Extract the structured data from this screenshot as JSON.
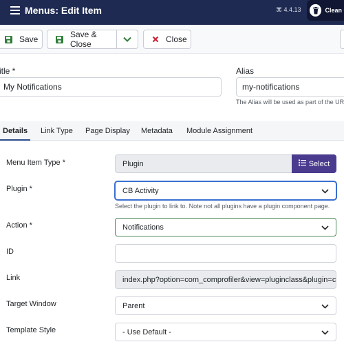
{
  "header": {
    "title": "Menus: Edit Item",
    "version": "⌘ 4.4.13",
    "clean_cache_label": "Clean C"
  },
  "toolbar": {
    "save_label": "Save",
    "save_close_label": "Save & Close",
    "close_label": "Close"
  },
  "details": {
    "title_label": "itle *",
    "title_value": "My Notifications",
    "alias_label": "Alias",
    "alias_value": "my-notifications",
    "alias_hint": "The Alias will be used as part of the UR"
  },
  "tabs": [
    {
      "label": "Details",
      "active": true
    },
    {
      "label": "Link Type"
    },
    {
      "label": "Page Display"
    },
    {
      "label": "Metadata"
    },
    {
      "label": "Module Assignment"
    }
  ],
  "form": {
    "menu_item_type": {
      "label": "Menu Item Type *",
      "value": "Plugin",
      "button": "Select"
    },
    "plugin": {
      "label": "Plugin *",
      "value": "CB Activity",
      "hint": "Select the plugin to link to. Note not all plugins have a plugin component page."
    },
    "action": {
      "label": "Action *",
      "value": "Notifications"
    },
    "id": {
      "label": "ID",
      "value": ""
    },
    "link": {
      "label": "Link",
      "value": "index.php?option=com_comprofiler&view=pluginclass&plugin=cl"
    },
    "target_window": {
      "label": "Target Window",
      "value": "Parent"
    },
    "template_style": {
      "label": "Template Style",
      "value": "- Use Default -"
    }
  },
  "colors": {
    "header_bg": "#1e2a52",
    "select_button": "#4b3b8f",
    "save_icon": "#2f7d3a",
    "close_icon": "#c8263b",
    "active_tab": "#2a4a8a"
  }
}
